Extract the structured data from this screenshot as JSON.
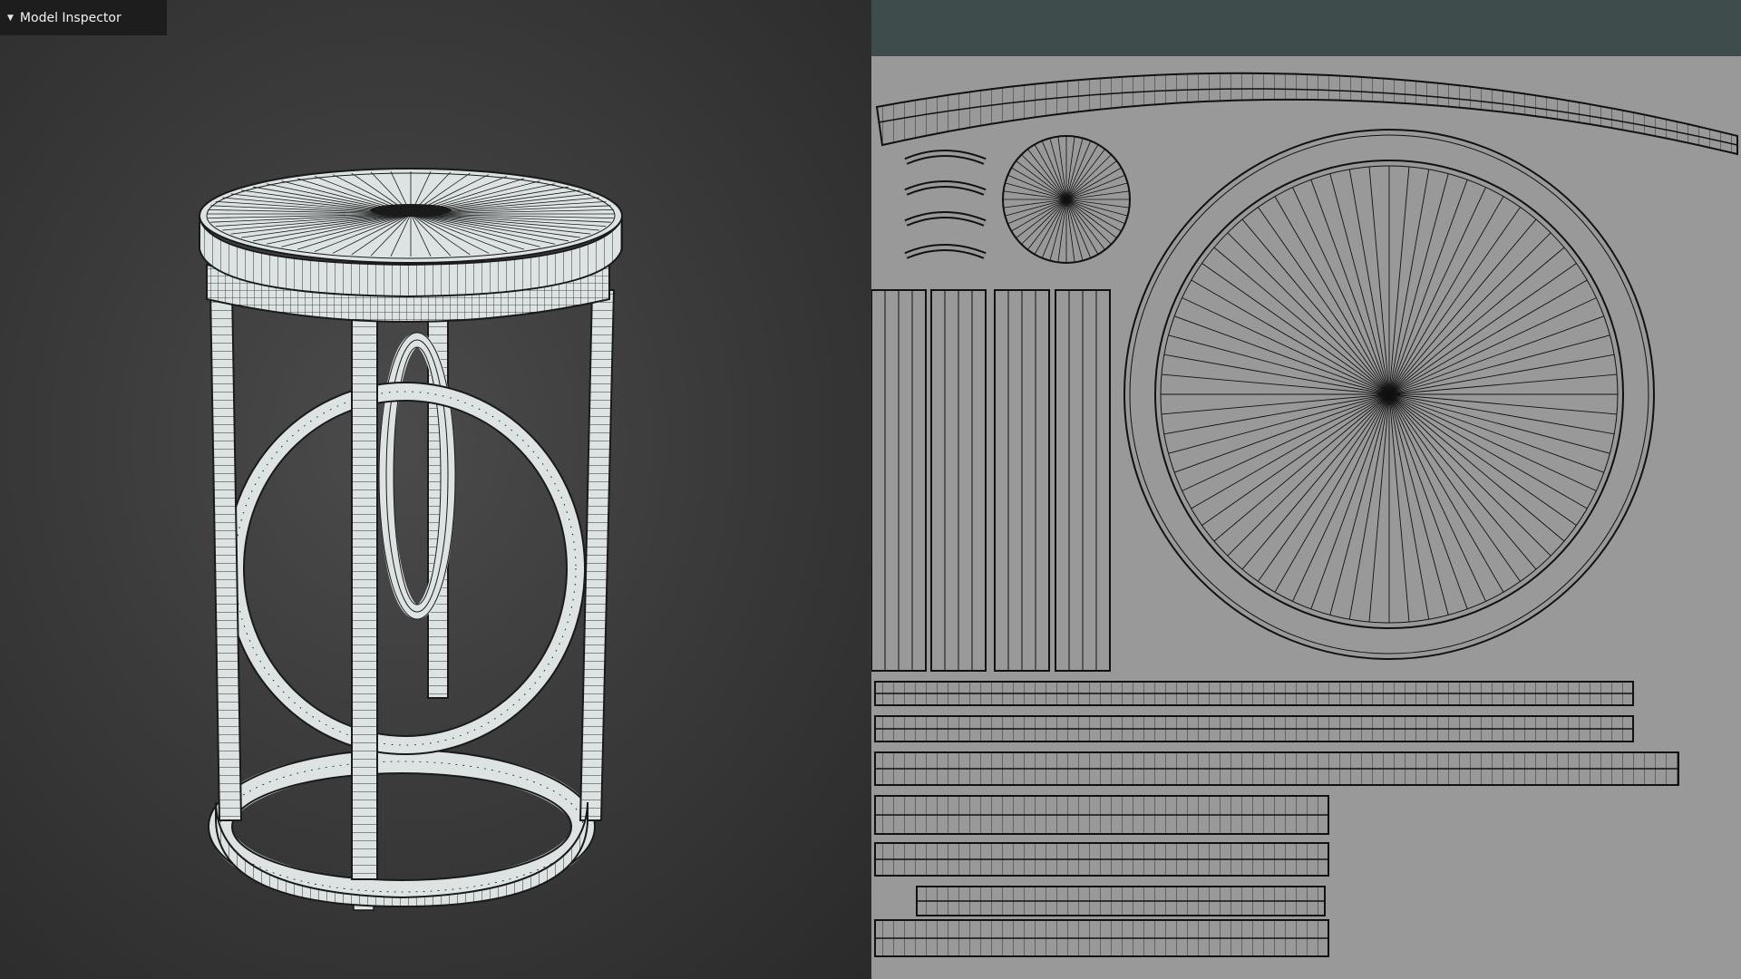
{
  "inspector": {
    "label": "Model Inspector",
    "caret_icon": "caret-down-icon"
  },
  "colors": {
    "viewport_bg": "#3b3b3b",
    "mesh_fill": "#dde3e3",
    "wire": "#1a1a1a",
    "uv_bg": "#999999",
    "uv_frame": "#3e4c4c",
    "overlay": "#232323"
  }
}
